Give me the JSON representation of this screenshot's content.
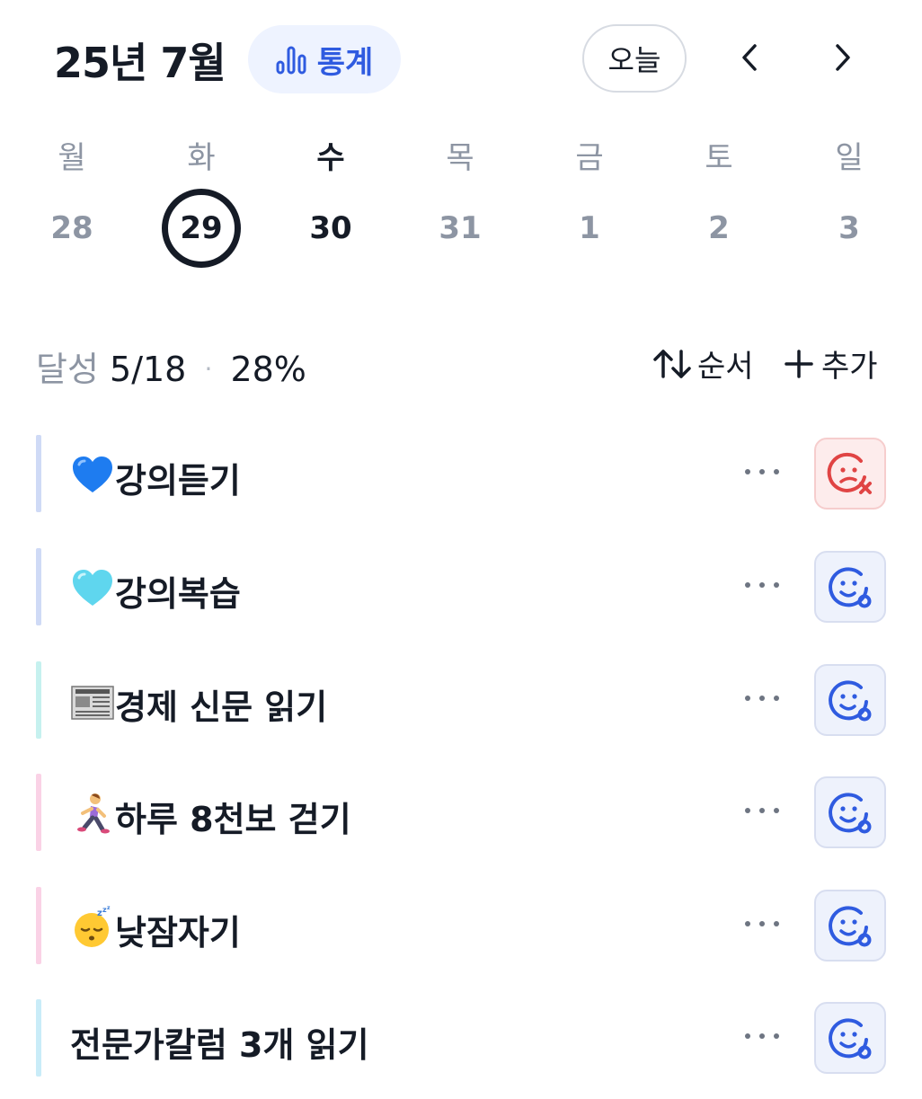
{
  "header": {
    "month_title": "25년 7월",
    "stats_label": "통계",
    "today_label": "오늘",
    "accent_color": "#2f5be0"
  },
  "week": {
    "weekdays": [
      "월",
      "화",
      "수",
      "목",
      "금",
      "토",
      "일"
    ],
    "days": [
      "28",
      "29",
      "30",
      "31",
      "1",
      "2",
      "3"
    ],
    "selected_day": "29",
    "today_day": "30"
  },
  "summary": {
    "label": "달성",
    "count": "5/18",
    "separator": "·",
    "percent": "28%",
    "order_label": "순서",
    "add_label": "추가"
  },
  "habits": [
    {
      "name": "강의듣기",
      "emoji": "blue-heart-icon",
      "bar_color": "#cfdaf6",
      "status": "fail",
      "more": "···"
    },
    {
      "name": "강의복습",
      "emoji": "light-blue-heart-icon",
      "bar_color": "#cfdaf6",
      "status": "pending",
      "more": "···"
    },
    {
      "name": "경제 신문 읽기",
      "emoji": "newspaper-icon",
      "bar_color": "#c6f1ef",
      "status": "pending",
      "more": "···"
    },
    {
      "name": "하루 8천보 걷기",
      "emoji": "running-woman-icon",
      "bar_color": "#fad2e6",
      "status": "pending",
      "more": "···"
    },
    {
      "name": "낮잠자기",
      "emoji": "sleeping-face-icon",
      "bar_color": "#fad2e6",
      "status": "pending",
      "more": "···"
    },
    {
      "name": "전문가칼럼 3개 읽기",
      "emoji": "",
      "bar_color": "#c9ecf8",
      "status": "pending",
      "more": "···"
    }
  ]
}
